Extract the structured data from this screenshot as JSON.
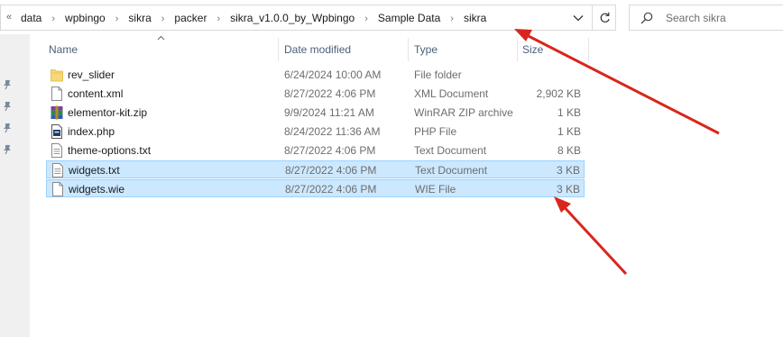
{
  "address_bar": {
    "overflow": "«",
    "breadcrumbs": [
      "data",
      "wpbingo",
      "sikra",
      "packer",
      "sikra_v1.0.0_by_Wpbingo",
      "Sample Data",
      "sikra"
    ],
    "separator": "›"
  },
  "search": {
    "placeholder": "Search sikra"
  },
  "columns": {
    "name": "Name",
    "date": "Date modified",
    "type": "Type",
    "size": "Size"
  },
  "files": [
    {
      "name": "rev_slider",
      "date": "6/24/2024 10:00 AM",
      "type": "File folder",
      "size": "",
      "icon": "folder-icon",
      "selected": false
    },
    {
      "name": "content.xml",
      "date": "8/27/2022 4:06 PM",
      "type": "XML Document",
      "size": "2,902 KB",
      "icon": "document-icon",
      "selected": false
    },
    {
      "name": "elementor-kit.zip",
      "date": "9/9/2024 11:21 AM",
      "type": "WinRAR ZIP archive",
      "size": "1 KB",
      "icon": "winrar-archive-icon",
      "selected": false
    },
    {
      "name": "index.php",
      "date": "8/24/2022 11:36 AM",
      "type": "PHP File",
      "size": "1 KB",
      "icon": "php-file-icon",
      "selected": false
    },
    {
      "name": "theme-options.txt",
      "date": "8/27/2022 4:06 PM",
      "type": "Text Document",
      "size": "8 KB",
      "icon": "text-file-icon",
      "selected": false
    },
    {
      "name": "widgets.txt",
      "date": "8/27/2022 4:06 PM",
      "type": "Text Document",
      "size": "3 KB",
      "icon": "text-file-icon",
      "selected": true
    },
    {
      "name": "widgets.wie",
      "date": "8/27/2022 4:06 PM",
      "type": "WIE File",
      "size": "3 KB",
      "icon": "document-icon",
      "selected": true
    }
  ],
  "colors": {
    "selection": "#cce8ff",
    "selection_border": "#99d1ff",
    "annotation_arrow": "#d9261c",
    "header_text": "#4c607a"
  }
}
